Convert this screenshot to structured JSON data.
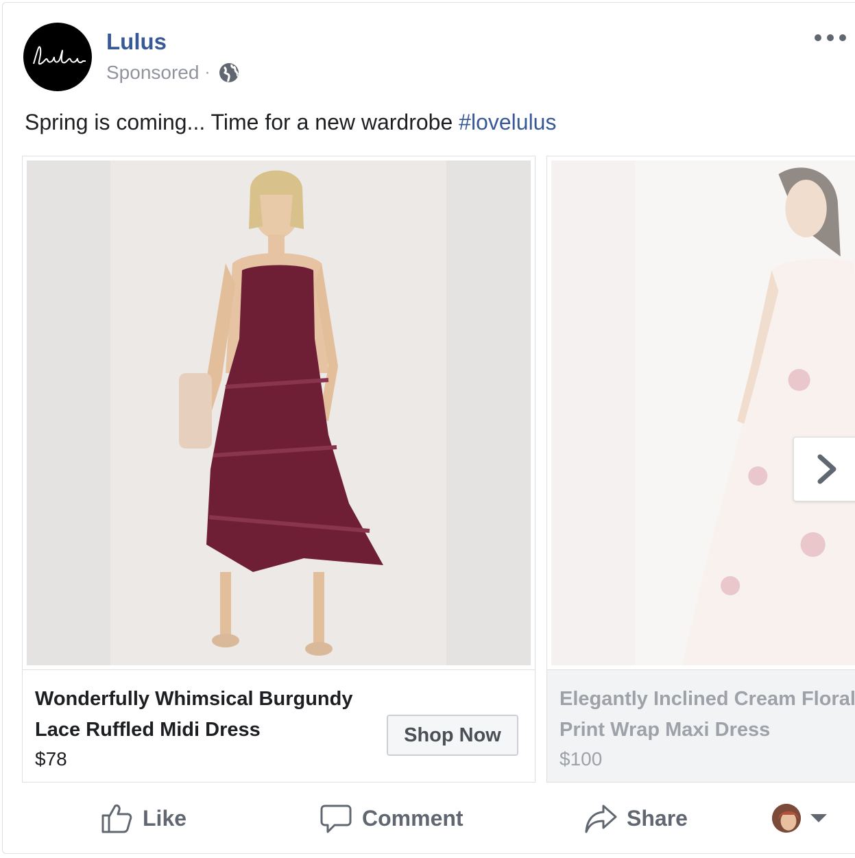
{
  "page": {
    "name": "Lulus",
    "logo_text": "Lulus",
    "sponsored": "Sponsored",
    "separator": "·"
  },
  "post": {
    "message": "Spring is coming... Time for a new wardrobe ",
    "hashtag": "#lovelulus"
  },
  "carousel": [
    {
      "title_line1": "Wonderfully Whimsical Burgundy",
      "title_line2": "Lace Ruffled Midi Dress",
      "price": "$78",
      "cta": "Shop Now",
      "dress_color": "#6e1f36"
    },
    {
      "title_line1": "Elegantly Inclined Cream Floral",
      "title_line2": "Print Wrap Maxi Dress",
      "price": "$100",
      "dress_color": "#f3e8e2"
    }
  ],
  "actions": {
    "like": "Like",
    "comment": "Comment",
    "share": "Share"
  },
  "colors": {
    "link": "#385898",
    "muted": "#90949c",
    "action": "#606770"
  },
  "icons": [
    "globe-icon",
    "more-icon",
    "next-arrow-icon",
    "like-icon",
    "comment-icon",
    "share-icon",
    "caret-down-icon"
  ]
}
